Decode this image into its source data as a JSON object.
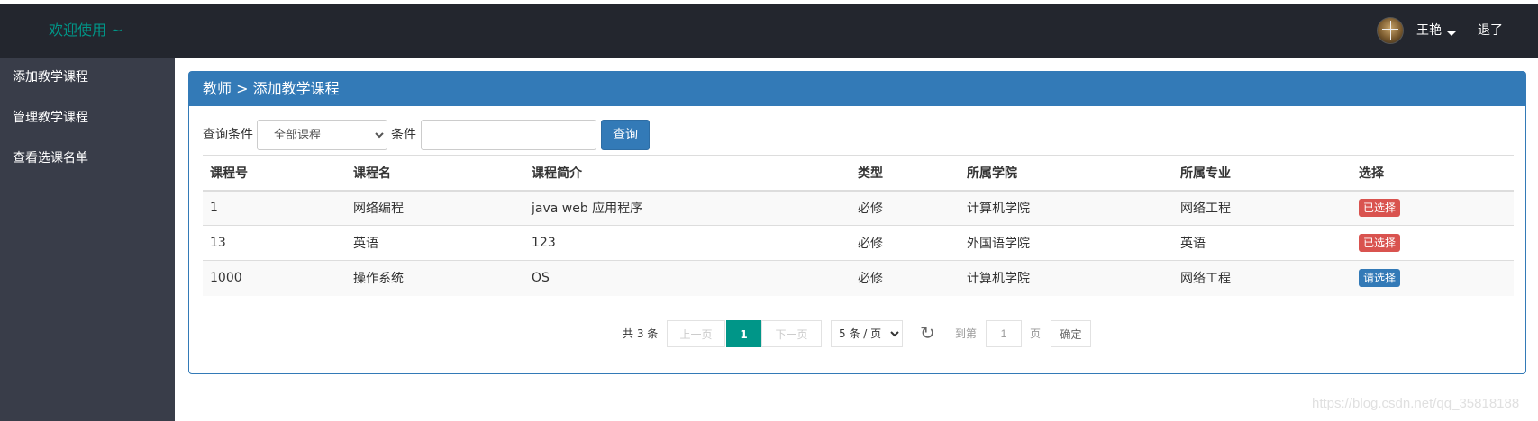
{
  "header": {
    "brand": "欢迎使用 ~",
    "username": "王艳",
    "logout": "退了"
  },
  "sidebar": {
    "items": [
      {
        "label": "添加教学课程"
      },
      {
        "label": "管理教学课程"
      },
      {
        "label": "查看选课名单"
      }
    ]
  },
  "panel": {
    "title": "教师 > 添加教学课程"
  },
  "search": {
    "label1": "查询条件",
    "select_value": "全部课程",
    "label2": "条件",
    "input_value": "",
    "button": "查询"
  },
  "table": {
    "columns": [
      "课程号",
      "课程名",
      "课程简介",
      "类型",
      "所属学院",
      "所属专业",
      "选择"
    ],
    "rows": [
      {
        "id": "1",
        "name": "网络编程",
        "intro": "java web 应用程序",
        "type": "必修",
        "college": "计算机学院",
        "major": "网络工程",
        "choose": "已选择",
        "choose_color": "#d9534f"
      },
      {
        "id": "13",
        "name": "英语",
        "intro": "123",
        "type": "必修",
        "college": "外国语学院",
        "major": "英语",
        "choose": "已选择",
        "choose_color": "#d9534f"
      },
      {
        "id": "1000",
        "name": "操作系统",
        "intro": "OS",
        "type": "必修",
        "college": "计算机学院",
        "major": "网络工程",
        "choose": "请选择",
        "choose_color": "#337ab7"
      }
    ]
  },
  "pager": {
    "total": "共 3 条",
    "prev": "上一页",
    "current": "1",
    "next": "下一页",
    "page_size": "5 条 / 页",
    "goto": "到第",
    "goto_value": "1",
    "page_unit": "页",
    "confirm": "确定"
  },
  "watermark": "https://blog.csdn.net/qq_35818188",
  "colors": {
    "topbar": "#23262e",
    "sidebar": "#393d49",
    "brand": "#009688",
    "primary": "#337ab7",
    "danger": "#d9534f"
  },
  "icons": {
    "refresh": "refresh-icon",
    "dropdown": "caret-down-icon"
  }
}
